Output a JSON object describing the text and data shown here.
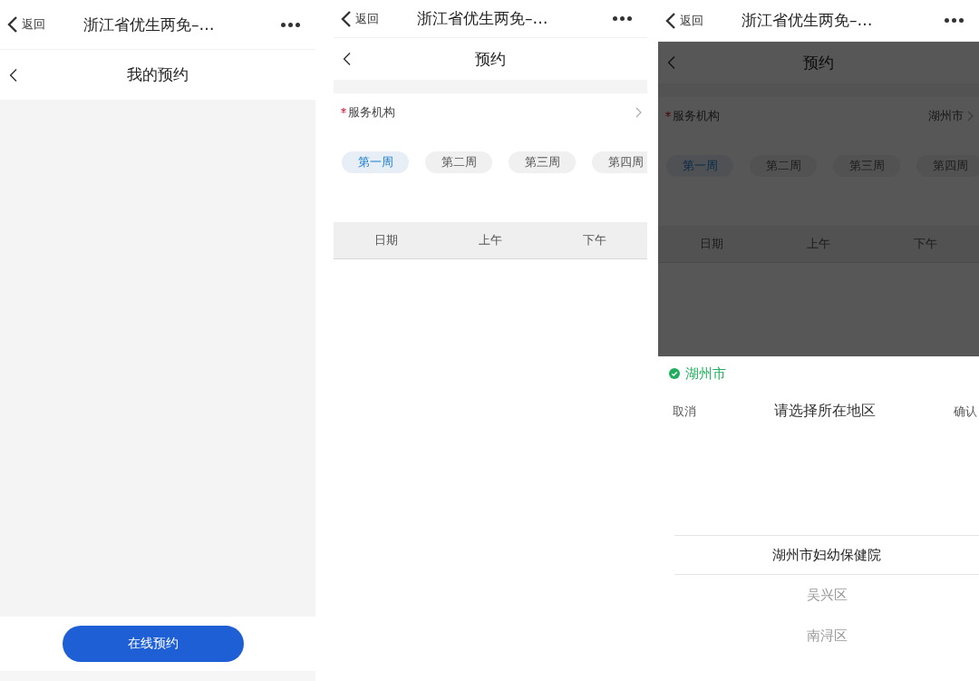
{
  "screens": [
    {
      "kind": "list",
      "top_bar": {
        "back": "返回",
        "title": "浙江省优生两免–…"
      },
      "page_title": "我的预约",
      "button": "在线预约"
    },
    {
      "kind": "booking",
      "top_bar": {
        "back": "返回",
        "title": "浙江省优生两免–…"
      },
      "page_title": "预约",
      "field": {
        "label": "服务机构",
        "required": true
      },
      "weeks": [
        {
          "label": "第一周",
          "selected": true
        },
        {
          "label": "第二周",
          "selected": false
        },
        {
          "label": "第三周",
          "selected": false
        },
        {
          "label": "第四周",
          "selected": false
        }
      ],
      "columns": [
        "日期",
        "上午",
        "下午"
      ]
    },
    {
      "kind": "booking",
      "dimmed": true,
      "top_bar": {
        "back": "返回",
        "title": "浙江省优生两免–…"
      },
      "page_title": "预约",
      "field": {
        "label": "服务机构",
        "required": true,
        "value": "湖州市"
      },
      "weeks": [
        {
          "label": "第一周",
          "selected": true
        },
        {
          "label": "第二周",
          "selected": false
        },
        {
          "label": "第三周",
          "selected": false
        },
        {
          "label": "第四周",
          "selected": false
        }
      ],
      "columns": [
        "日期",
        "上午",
        "下午"
      ],
      "picker": {
        "location": "湖州市",
        "cancel": "取消",
        "title": "请选择所在地区",
        "confirm": "确认",
        "options": [
          {
            "label": "湖州市妇幼保健院",
            "selected": true
          },
          {
            "label": "吴兴区",
            "selected": false
          },
          {
            "label": "南浔区",
            "selected": false
          }
        ]
      }
    }
  ]
}
